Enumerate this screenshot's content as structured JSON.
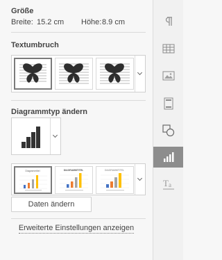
{
  "size": {
    "title": "Größe",
    "width_label": "Breite:",
    "width_value": "15.2 cm",
    "height_label": "Höhe:",
    "height_value": "8.9 cm"
  },
  "wrap": {
    "title": "Textumbruch"
  },
  "chart_type": {
    "title": "Diagrammtyp ändern"
  },
  "style_thumbs": [
    {
      "title": "Diagrammtitel"
    },
    {
      "title": "DIAGRAMMTITEL"
    },
    {
      "title": "DIAGRAMMTITEL"
    }
  ],
  "buttons": {
    "edit_data": "Daten ändern"
  },
  "links": {
    "advanced": "Erweiterte Einstellungen anzeigen"
  },
  "colors": {
    "active_tab": "#8d8d8d",
    "bar_blue": "#4472c4",
    "bar_orange": "#ed7d31",
    "bar_gray": "#a5a5a5",
    "bar_yellow": "#ffc000"
  },
  "sidebar_icons": [
    "paragraph-icon",
    "table-icon",
    "image-icon",
    "header-footer-icon",
    "shape-icon",
    "chart-icon",
    "text-art-icon"
  ]
}
